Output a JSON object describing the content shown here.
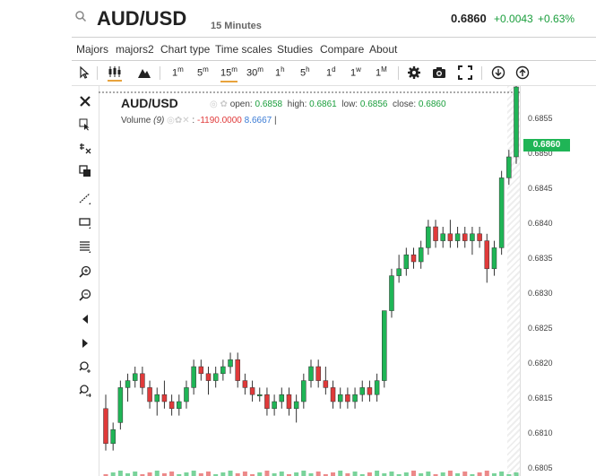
{
  "header": {
    "symbol": "AUD/USD",
    "timeframe": "15 Minutes",
    "price": "0.6860",
    "change": "+0.0043",
    "change_pct": "+0.63%"
  },
  "menu": [
    "Majors",
    "majors2",
    "Chart type",
    "Time scales",
    "Studies",
    "Compare",
    "About"
  ],
  "toolbar": {
    "intervals": [
      {
        "n": "1",
        "u": "m"
      },
      {
        "n": "5",
        "u": "m"
      },
      {
        "n": "15",
        "u": "m"
      },
      {
        "n": "30",
        "u": "m"
      },
      {
        "n": "1",
        "u": "h"
      },
      {
        "n": "5",
        "u": "h"
      },
      {
        "n": "1",
        "u": "d"
      },
      {
        "n": "1",
        "u": "w"
      },
      {
        "n": "1",
        "u": "M"
      }
    ],
    "active_interval": "15m"
  },
  "legend": {
    "symbol": "AUD/USD",
    "open_label": "open:",
    "open": "0.6858",
    "high_label": "high:",
    "high": "0.6861",
    "low_label": "low:",
    "low": "0.6856",
    "close_label": "close:",
    "close": "0.6860",
    "volume_label": "Volume",
    "volume_period": "(9)",
    "volume_val1": "-1190.0000",
    "volume_val2": "8.6667"
  },
  "yaxis": {
    "ticks": [
      "0.6855",
      "0.6850",
      "0.6845",
      "0.6840",
      "0.6835",
      "0.6830",
      "0.6825",
      "0.6820",
      "0.6815",
      "0.6810",
      "0.6805"
    ],
    "current_tag": "0.6860"
  },
  "colors": {
    "up": "#1fb556",
    "down": "#e03a3a",
    "accent": "#e8a33c"
  },
  "chart_data": {
    "type": "candlestick",
    "ylim": [
      0.6804,
      0.686
    ],
    "candles": [
      [
        0.6814,
        0.6816,
        0.6808,
        0.6809
      ],
      [
        0.6809,
        0.6812,
        0.6808,
        0.6811
      ],
      [
        0.6812,
        0.6818,
        0.6811,
        0.6817
      ],
      [
        0.6817,
        0.6819,
        0.6815,
        0.6818
      ],
      [
        0.6818,
        0.682,
        0.6817,
        0.6819
      ],
      [
        0.6819,
        0.682,
        0.6816,
        0.6817
      ],
      [
        0.6817,
        0.6818,
        0.6814,
        0.6815
      ],
      [
        0.6815,
        0.6817,
        0.6813,
        0.6816
      ],
      [
        0.6816,
        0.6818,
        0.6814,
        0.6815
      ],
      [
        0.6815,
        0.6816,
        0.6813,
        0.6814
      ],
      [
        0.6814,
        0.6816,
        0.6813,
        0.6815
      ],
      [
        0.6815,
        0.6818,
        0.6814,
        0.6817
      ],
      [
        0.6817,
        0.6821,
        0.6816,
        0.682
      ],
      [
        0.682,
        0.6821,
        0.6818,
        0.6819
      ],
      [
        0.6819,
        0.682,
        0.6816,
        0.6818
      ],
      [
        0.6818,
        0.682,
        0.6817,
        0.6819
      ],
      [
        0.6819,
        0.6821,
        0.6818,
        0.682
      ],
      [
        0.682,
        0.6822,
        0.6819,
        0.6821
      ],
      [
        0.6821,
        0.6822,
        0.6817,
        0.6818
      ],
      [
        0.6818,
        0.6819,
        0.6816,
        0.6817
      ],
      [
        0.6817,
        0.6818,
        0.6815,
        0.6816
      ],
      [
        0.6816,
        0.6817,
        0.6815,
        0.6816
      ],
      [
        0.6816,
        0.6817,
        0.6813,
        0.6814
      ],
      [
        0.6814,
        0.6816,
        0.6813,
        0.6815
      ],
      [
        0.6815,
        0.6817,
        0.6814,
        0.6816
      ],
      [
        0.6816,
        0.6817,
        0.6813,
        0.6814
      ],
      [
        0.6814,
        0.6816,
        0.6812,
        0.6815
      ],
      [
        0.6815,
        0.6819,
        0.6814,
        0.6818
      ],
      [
        0.6818,
        0.6821,
        0.6817,
        0.682
      ],
      [
        0.682,
        0.6821,
        0.6817,
        0.6818
      ],
      [
        0.6818,
        0.682,
        0.6816,
        0.6817
      ],
      [
        0.6817,
        0.6818,
        0.6814,
        0.6815
      ],
      [
        0.6815,
        0.6817,
        0.6814,
        0.6816
      ],
      [
        0.6816,
        0.6817,
        0.6814,
        0.6815
      ],
      [
        0.6815,
        0.6817,
        0.6814,
        0.6816
      ],
      [
        0.6816,
        0.6818,
        0.6815,
        0.6817
      ],
      [
        0.6817,
        0.6818,
        0.6815,
        0.6816
      ],
      [
        0.6816,
        0.6819,
        0.6815,
        0.6818
      ],
      [
        0.6818,
        0.6828,
        0.6817,
        0.6828
      ],
      [
        0.6828,
        0.6834,
        0.6827,
        0.6833
      ],
      [
        0.6833,
        0.6836,
        0.6832,
        0.6834
      ],
      [
        0.6834,
        0.6837,
        0.6833,
        0.6836
      ],
      [
        0.6836,
        0.6837,
        0.6834,
        0.6835
      ],
      [
        0.6835,
        0.6838,
        0.6834,
        0.6837
      ],
      [
        0.6837,
        0.6841,
        0.6836,
        0.684
      ],
      [
        0.684,
        0.6841,
        0.6837,
        0.6838
      ],
      [
        0.6838,
        0.684,
        0.6837,
        0.6839
      ],
      [
        0.6839,
        0.6841,
        0.6837,
        0.6838
      ],
      [
        0.6838,
        0.684,
        0.6837,
        0.6839
      ],
      [
        0.6839,
        0.684,
        0.6837,
        0.6838
      ],
      [
        0.6838,
        0.684,
        0.6836,
        0.6839
      ],
      [
        0.6839,
        0.684,
        0.6837,
        0.6838
      ],
      [
        0.6838,
        0.6839,
        0.6832,
        0.6834
      ],
      [
        0.6834,
        0.6838,
        0.6833,
        0.6837
      ],
      [
        0.6837,
        0.6848,
        0.6836,
        0.6847
      ],
      [
        0.6847,
        0.6851,
        0.6846,
        0.685
      ],
      [
        0.685,
        0.6861,
        0.6849,
        0.686
      ]
    ]
  }
}
